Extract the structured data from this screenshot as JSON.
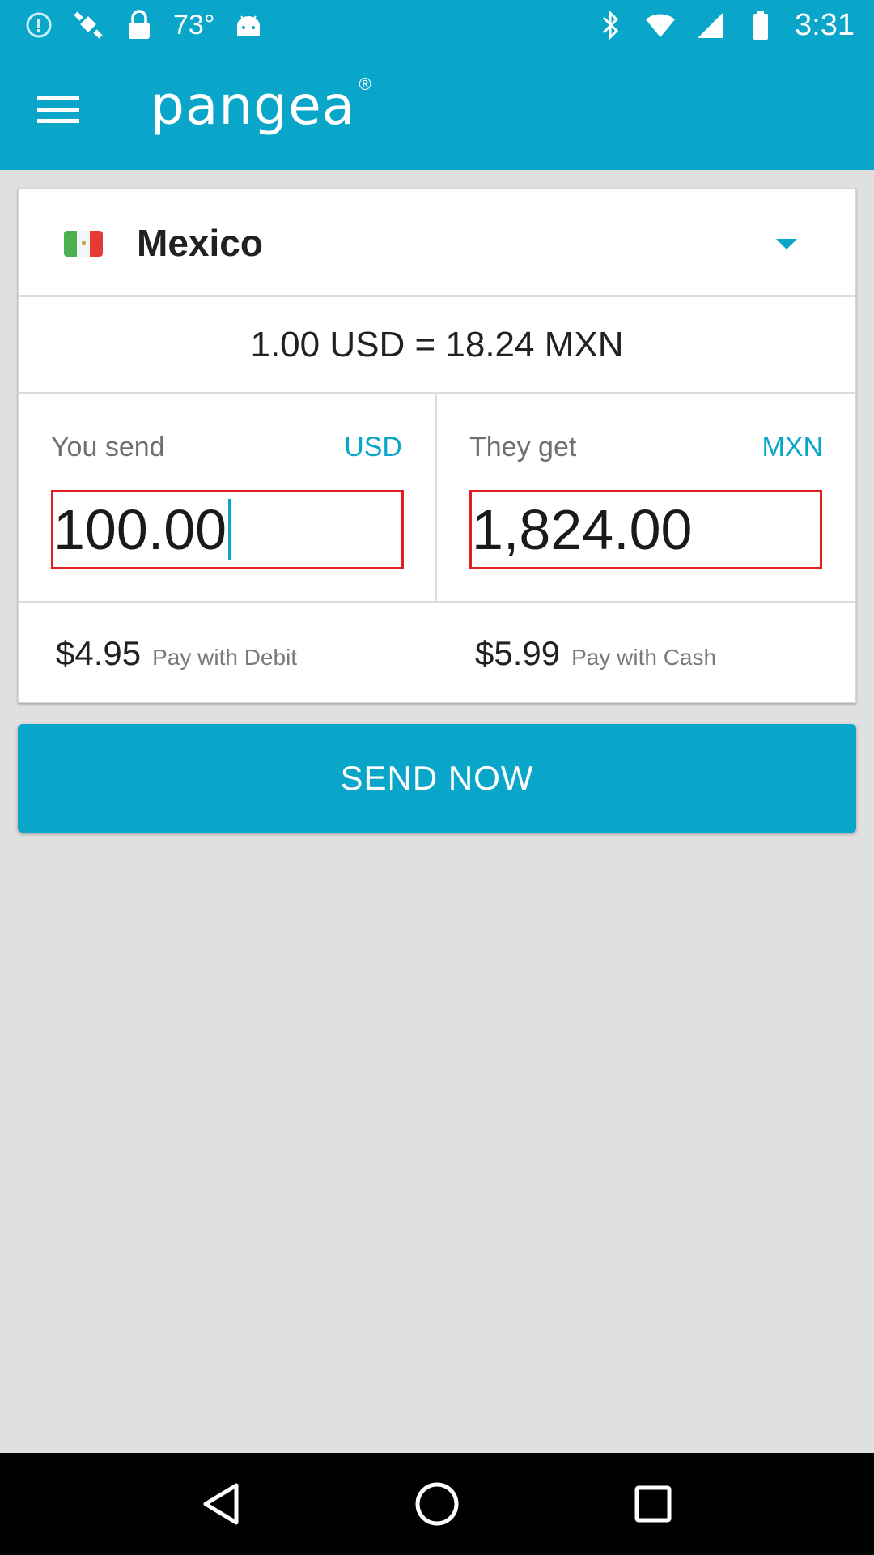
{
  "status_bar": {
    "temperature": "73°",
    "time": "3:31",
    "left_icons": [
      "alert-icon",
      "satellite-icon",
      "lock-icon",
      "android-icon"
    ],
    "right_icons": [
      "bluetooth-icon",
      "wifi-icon",
      "signal-icon",
      "battery-icon"
    ]
  },
  "app_bar": {
    "logo": "pangea"
  },
  "country": {
    "name": "Mexico"
  },
  "rate": {
    "text": "1.00 USD = 18.24 MXN"
  },
  "send": {
    "label": "You send",
    "currency": "USD",
    "amount": "100.00"
  },
  "receive": {
    "label": "They get",
    "currency": "MXN",
    "amount": "1,824.00"
  },
  "fees": {
    "debit_amount": "$4.95",
    "debit_label": "Pay with Debit",
    "cash_amount": "$5.99",
    "cash_label": "Pay with Cash"
  },
  "send_button": {
    "label": "SEND NOW"
  },
  "colors": {
    "accent": "#0aa6c9",
    "input_border": "#e02020",
    "background": "#e0e0e0"
  }
}
